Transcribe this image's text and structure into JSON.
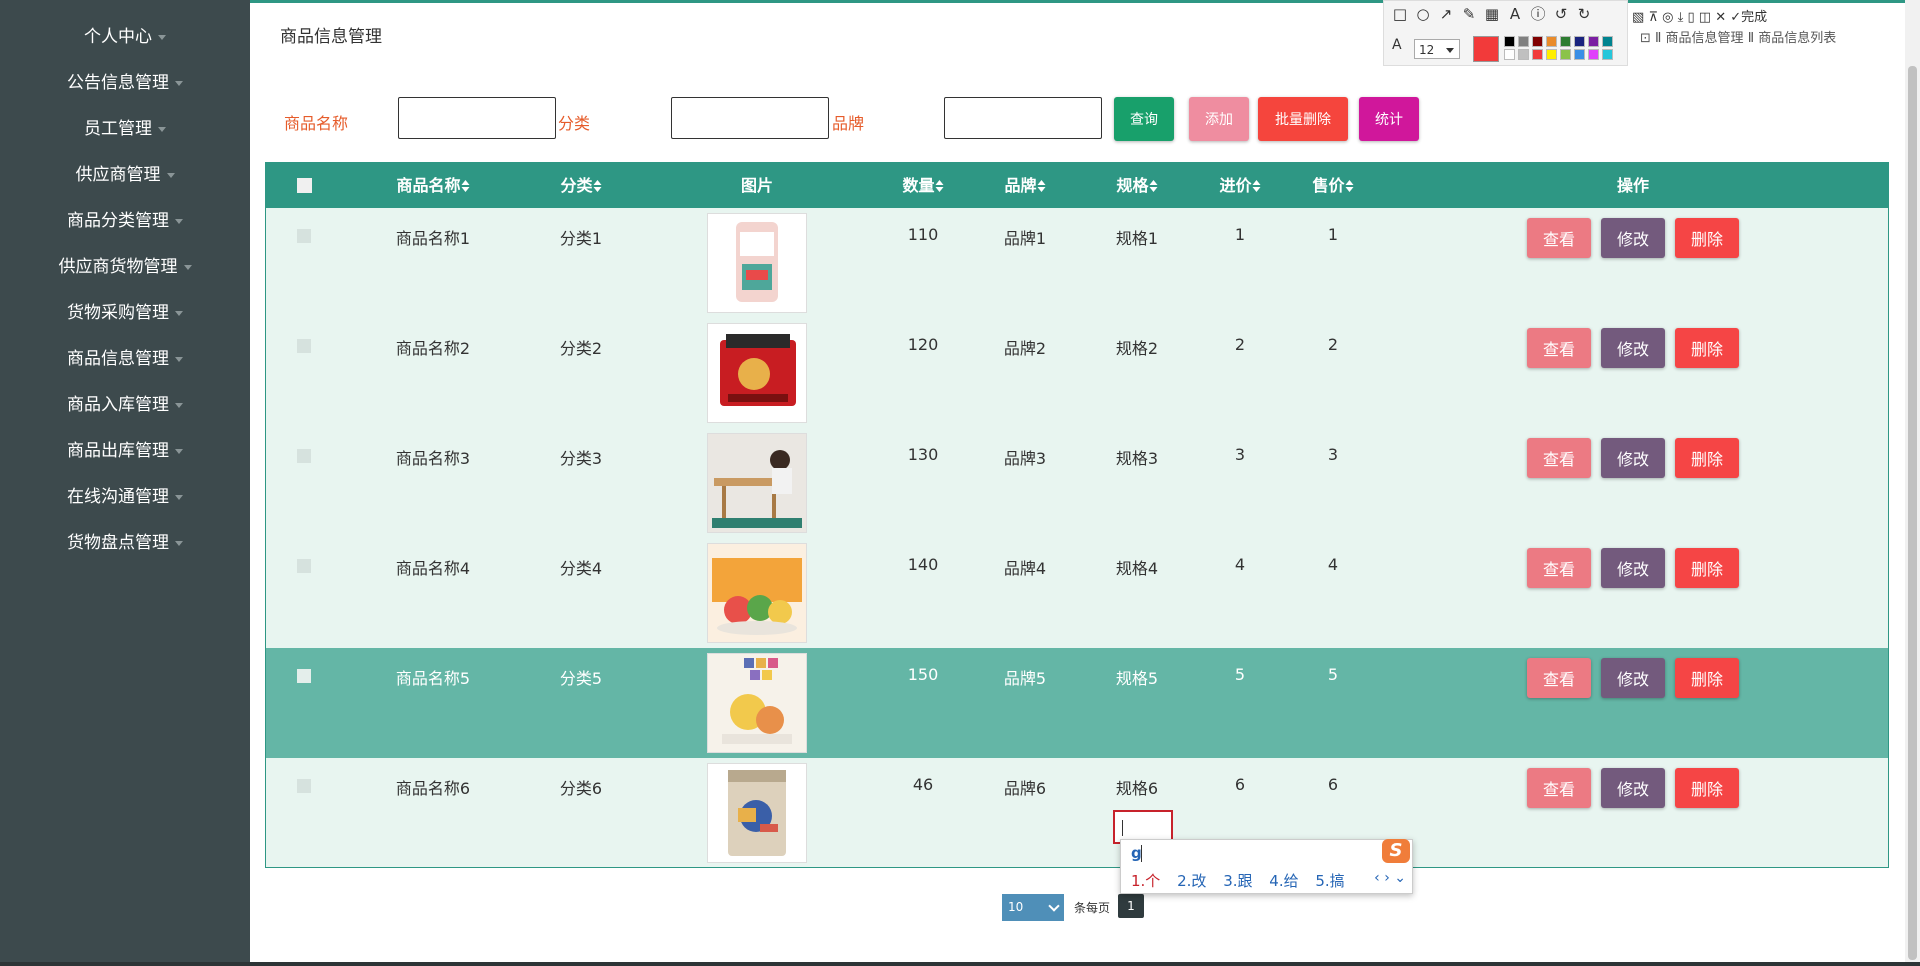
{
  "sidebar": {
    "items": [
      {
        "label": "个人中心"
      },
      {
        "label": "公告信息管理"
      },
      {
        "label": "员工管理"
      },
      {
        "label": "供应商管理"
      },
      {
        "label": "商品分类管理"
      },
      {
        "label": "供应商货物管理"
      },
      {
        "label": "货物采购管理"
      },
      {
        "label": "商品信息管理"
      },
      {
        "label": "商品入库管理"
      },
      {
        "label": "商品出库管理"
      },
      {
        "label": "在线沟通管理"
      },
      {
        "label": "货物盘点管理"
      }
    ]
  },
  "page": {
    "title": "商品信息管理"
  },
  "breadcrumb": {
    "text": "⊡ Ⅱ 商品信息管理 Ⅱ 商品信息列表"
  },
  "search": {
    "name_label": "商品名称",
    "category_label": "分类",
    "brand_label": "品牌",
    "buttons": {
      "query": "查询",
      "add": "添加",
      "batch_delete": "批量删除",
      "stats": "统计"
    }
  },
  "table": {
    "headers": {
      "name": "商品名称",
      "category": "分类",
      "image": "图片",
      "quantity": "数量",
      "brand": "品牌",
      "spec": "规格",
      "purchase_price": "进价",
      "sale_price": "售价",
      "actions": "操作"
    },
    "action_labels": {
      "view": "查看",
      "edit": "修改",
      "delete": "删除"
    },
    "rows": [
      {
        "name": "商品名称1",
        "category": "分类1",
        "quantity": "110",
        "brand": "品牌1",
        "spec": "规格1",
        "purchase_price": "1",
        "sale_price": "1"
      },
      {
        "name": "商品名称2",
        "category": "分类2",
        "quantity": "120",
        "brand": "品牌2",
        "spec": "规格2",
        "purchase_price": "2",
        "sale_price": "2"
      },
      {
        "name": "商品名称3",
        "category": "分类3",
        "quantity": "130",
        "brand": "品牌3",
        "spec": "规格3",
        "purchase_price": "3",
        "sale_price": "3"
      },
      {
        "name": "商品名称4",
        "category": "分类4",
        "quantity": "140",
        "brand": "品牌4",
        "spec": "规格4",
        "purchase_price": "4",
        "sale_price": "4"
      },
      {
        "name": "商品名称5",
        "category": "分类5",
        "quantity": "150",
        "brand": "品牌5",
        "spec": "规格5",
        "purchase_price": "5",
        "sale_price": "5"
      },
      {
        "name": "商品名称6",
        "category": "分类6",
        "quantity": "46",
        "brand": "品牌6",
        "spec": "规格6",
        "purchase_price": "6",
        "sale_price": "6"
      }
    ]
  },
  "pagination": {
    "page_size": "10",
    "per_page_label": "条每页",
    "current_page": "1"
  },
  "ime": {
    "composition": "g",
    "candidates": [
      "1.个",
      "2.改",
      "3.跟",
      "4.给",
      "5.搞"
    ],
    "nav": "‹ › ⌄",
    "logo": "S"
  },
  "screenshot_toolbar": {
    "font_size": "12",
    "font_icon": "A",
    "done_label": "完成"
  },
  "colors": {
    "theme": "#2e9784",
    "sidebar": "#3d4a4d",
    "query_button": "#18a06b",
    "add_button": "#ef8da0",
    "batch_delete_button": "#f5453d",
    "stats_button": "#d0179b",
    "view_button": "#ec7a83",
    "edit_button": "#735a7d",
    "delete_button": "#f54545",
    "label_text": "#e65c2b"
  }
}
